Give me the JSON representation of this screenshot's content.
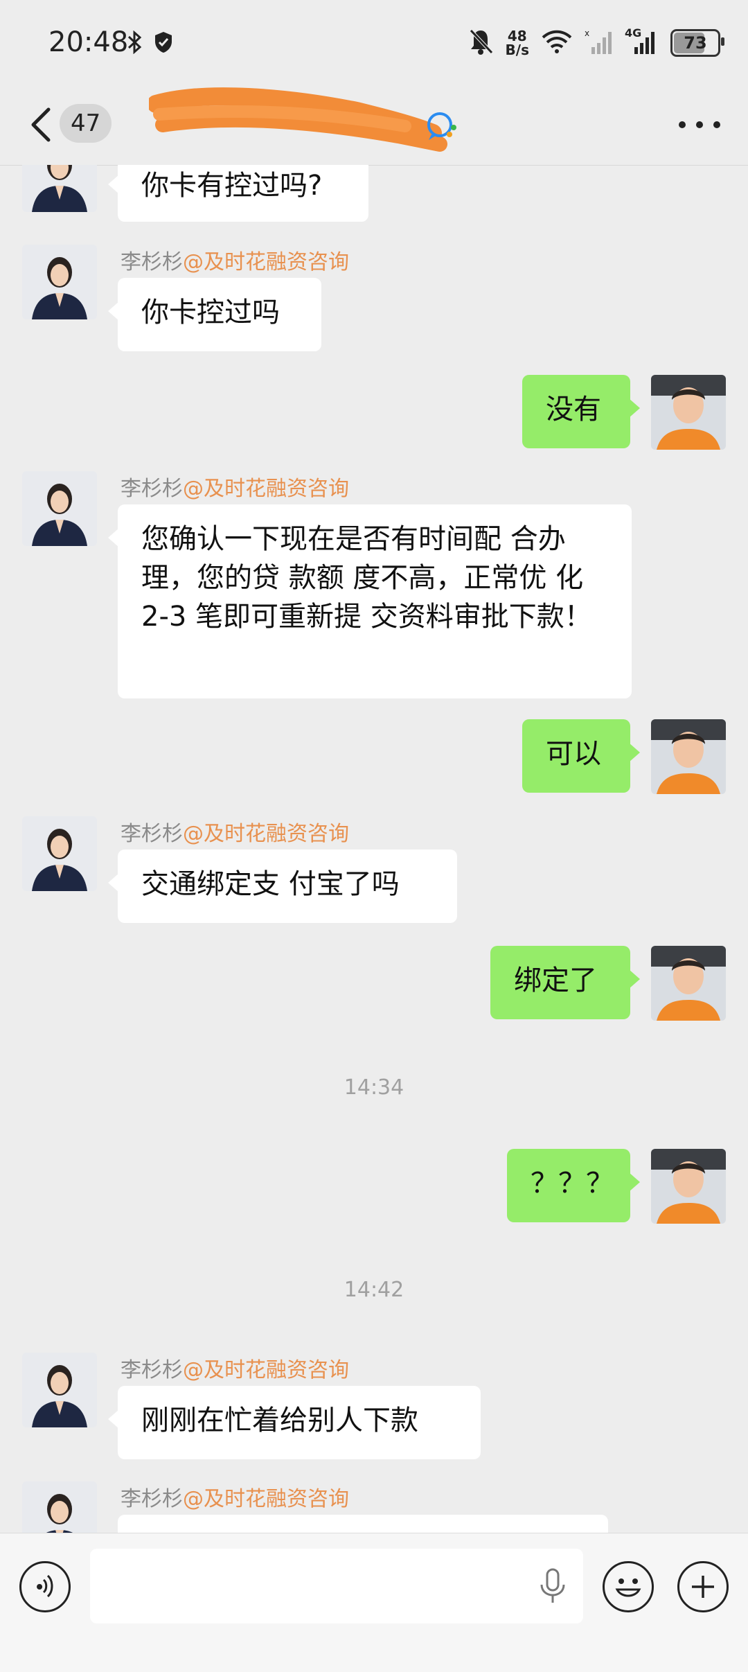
{
  "status_bar": {
    "time": "20:48",
    "net_speed_value": "48",
    "net_speed_unit": "B/s",
    "network_type": "4G",
    "battery": "73",
    "battery_level_percent": 73
  },
  "header": {
    "unread_count": "47",
    "more_icon": "more-dots-icon"
  },
  "chat": {
    "sender_name": "李杉杉",
    "sender_org": "@及时花融资咨询",
    "messages": [
      {
        "dir": "in",
        "text": "你卡有控过吗?"
      },
      {
        "dir": "in",
        "text": "你卡控过吗"
      },
      {
        "dir": "out",
        "text": "没有"
      },
      {
        "dir": "in",
        "text": "您确认一下现在是否有时间配 合办 理，您的贷 款额 度不高，正常优 化 2-3 笔即可重新提 交资料审批下款！"
      },
      {
        "dir": "out",
        "text": "可以"
      },
      {
        "dir": "in",
        "text": "交通绑定支 付宝了吗"
      },
      {
        "dir": "out",
        "text": "绑定了"
      },
      {
        "dir": "time",
        "text": "14:34"
      },
      {
        "dir": "out",
        "text": "？？？"
      },
      {
        "dir": "time",
        "text": "14:42"
      },
      {
        "dir": "in",
        "text": "刚刚在忙着给别人下款"
      }
    ]
  },
  "input_bar": {
    "voice_icon": "voice-icon",
    "mic_icon": "mic-icon",
    "emoji_icon": "emoji-icon",
    "plus_icon": "plus-icon"
  },
  "colors": {
    "background": "#ededed",
    "outgoing_bubble": "#95ec69",
    "incoming_bubble": "#ffffff",
    "sender_org": "#e8914f"
  }
}
